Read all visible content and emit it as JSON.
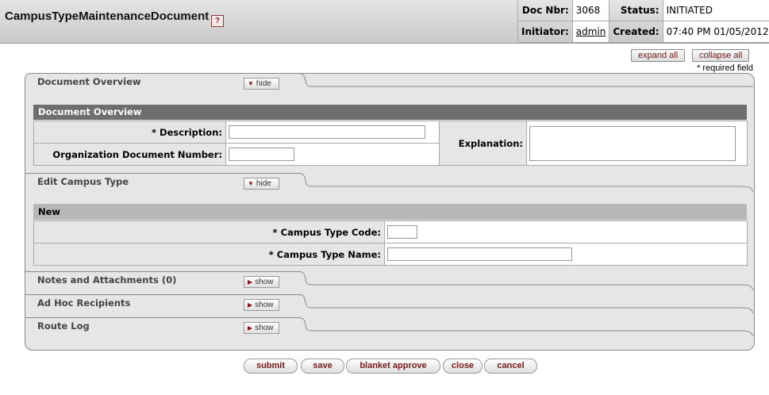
{
  "header": {
    "title": "CampusTypeMaintenanceDocument",
    "help_icon": "?",
    "doc_nbr_label": "Doc Nbr:",
    "doc_nbr": "3068",
    "status_label": "Status:",
    "status": "INITIATED",
    "initiator_label": "Initiator:",
    "initiator": "admin",
    "created_label": "Created:",
    "created": "07:40 PM 01/05/2012"
  },
  "toolbar": {
    "expand_all": "expand all",
    "collapse_all": "collapse all",
    "required_note": "* required field"
  },
  "tabs": {
    "doc_overview": {
      "label": "Document Overview",
      "toggle": "hide"
    },
    "edit_campus_type": {
      "label": "Edit Campus Type",
      "toggle": "hide"
    },
    "notes": {
      "label": "Notes and Attachments (0)",
      "toggle": "show"
    },
    "adhoc": {
      "label": "Ad Hoc Recipients",
      "toggle": "show"
    },
    "route_log": {
      "label": "Route Log",
      "toggle": "show"
    }
  },
  "doc_overview": {
    "section_title": "Document Overview",
    "description_label": "*  Description:",
    "description_value": "",
    "org_doc_number_label": "Organization Document Number:",
    "org_doc_number_value": "",
    "explanation_label": "Explanation:",
    "explanation_value": ""
  },
  "campus_type": {
    "section_title": "New",
    "code_label": "*  Campus Type Code:",
    "code_value": "",
    "name_label": "*  Campus Type Name:",
    "name_value": ""
  },
  "actions": {
    "submit": "submit",
    "save": "save",
    "blanket_approve": "blanket approve",
    "close": "close",
    "cancel": "cancel"
  }
}
